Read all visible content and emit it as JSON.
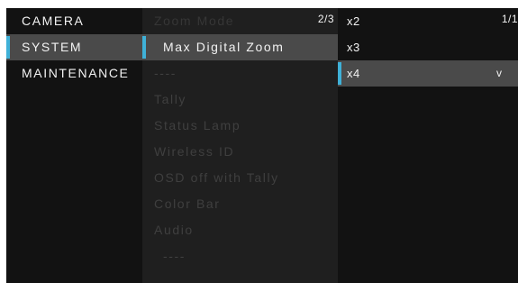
{
  "colors": {
    "accent": "#3fb1d8",
    "background": "#121212",
    "panel": "#1f1f1f",
    "selection": "#4a4a4a",
    "text": "#f2f2f2",
    "disabled_text": "#3f3f3f"
  },
  "main_menu": {
    "items": [
      {
        "label": "CAMERA"
      },
      {
        "label": "SYSTEM",
        "selected": true
      },
      {
        "label": "MAINTENANCE"
      }
    ]
  },
  "system_menu": {
    "page": "2/3",
    "header": "Zoom Mode",
    "items": [
      {
        "label": "Max Digital Zoom",
        "active": true
      },
      {
        "label": "----"
      },
      {
        "label": "Tally"
      },
      {
        "label": "Status Lamp"
      },
      {
        "label": "Wireless ID"
      },
      {
        "label": "OSD off with Tally"
      },
      {
        "label": "Color Bar"
      },
      {
        "label": "Audio"
      },
      {
        "label": "----"
      }
    ]
  },
  "zoom_options": {
    "page": "1/1",
    "items": [
      {
        "label": "x2"
      },
      {
        "label": "x3"
      },
      {
        "label": "x4",
        "selected": true,
        "mark": "v"
      }
    ]
  }
}
